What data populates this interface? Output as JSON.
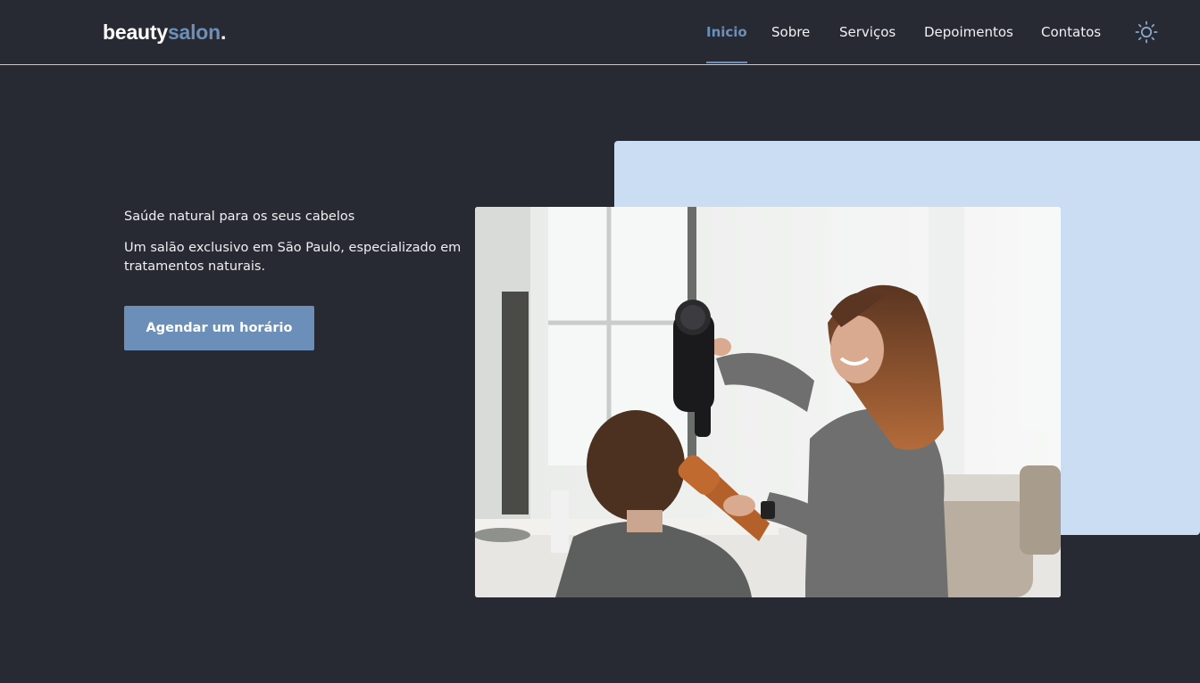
{
  "brand": {
    "name_part1": "beauty",
    "name_part2": "salon",
    "name_dot": ".",
    "accent_color": "#6b8fb8"
  },
  "nav": {
    "items": [
      {
        "label": "Inicio",
        "active": true
      },
      {
        "label": "Sobre",
        "active": false
      },
      {
        "label": "Serviços",
        "active": false
      },
      {
        "label": "Depoimentos",
        "active": false
      },
      {
        "label": "Contatos",
        "active": false
      }
    ],
    "theme_toggle_icon": "sun-icon"
  },
  "hero": {
    "subtitle": "Saúde natural para os seus cabelos",
    "description": "Um salão exclusivo em São Paulo, especializado em tratamentos naturais.",
    "cta_label": "Agendar um horário",
    "image_icon": "salon-photo"
  },
  "colors": {
    "background": "#282a33",
    "backdrop": "#cbddf3",
    "button": "#6b8fb8"
  }
}
